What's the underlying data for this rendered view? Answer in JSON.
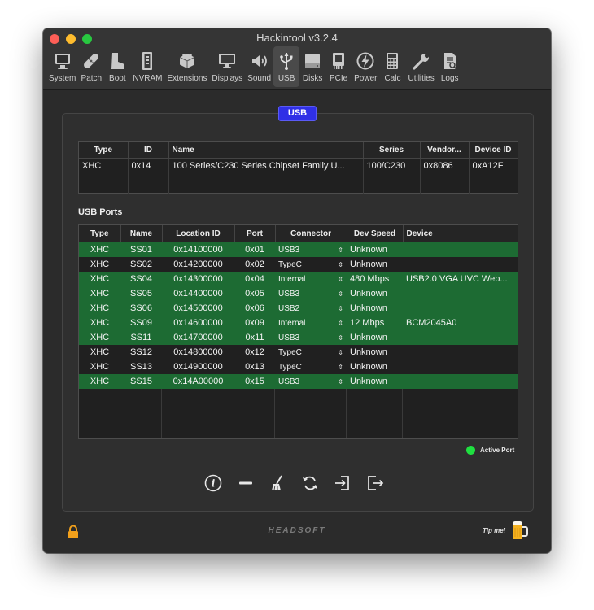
{
  "app": {
    "title": "Hackintool v3.2.4"
  },
  "toolbar": [
    {
      "label": "System",
      "icon": "system-icon"
    },
    {
      "label": "Patch",
      "icon": "patch-icon"
    },
    {
      "label": "Boot",
      "icon": "boot-icon"
    },
    {
      "label": "NVRAM",
      "icon": "nvram-icon"
    },
    {
      "label": "Extensions",
      "icon": "extensions-icon"
    },
    {
      "label": "Displays",
      "icon": "displays-icon"
    },
    {
      "label": "Sound",
      "icon": "sound-icon"
    },
    {
      "label": "USB",
      "icon": "usb-icon",
      "active": true
    },
    {
      "label": "Disks",
      "icon": "disks-icon"
    },
    {
      "label": "PCIe",
      "icon": "pcie-icon"
    },
    {
      "label": "Power",
      "icon": "power-icon"
    },
    {
      "label": "Calc",
      "icon": "calc-icon"
    },
    {
      "label": "Utilities",
      "icon": "utilities-icon"
    },
    {
      "label": "Logs",
      "icon": "logs-icon"
    }
  ],
  "panel": {
    "badge": "USB"
  },
  "controllers": {
    "columns": [
      "Type",
      "ID",
      "Name",
      "Series",
      "Vendor...",
      "Device ID"
    ],
    "rows": [
      {
        "type": "XHC",
        "id": "0x14",
        "name": "100 Series/C230 Series Chipset Family U...",
        "series": "100/C230",
        "vendor": "0x8086",
        "device_id": "0xA12F"
      }
    ]
  },
  "usb_ports": {
    "title": "USB Ports",
    "columns": [
      "Type",
      "Name",
      "Location ID",
      "Port",
      "Connector",
      "Dev Speed",
      "Device"
    ],
    "rows": [
      {
        "type": "XHC",
        "name": "SS01",
        "location": "0x14100000",
        "port": "0x01",
        "connector": "USB3",
        "speed": "Unknown",
        "device": "",
        "active": true
      },
      {
        "type": "XHC",
        "name": "SS02",
        "location": "0x14200000",
        "port": "0x02",
        "connector": "TypeC",
        "speed": "Unknown",
        "device": "",
        "active": false
      },
      {
        "type": "XHC",
        "name": "SS04",
        "location": "0x14300000",
        "port": "0x04",
        "connector": "Internal",
        "speed": "480 Mbps",
        "device": "USB2.0 VGA UVC Web...",
        "active": true
      },
      {
        "type": "XHC",
        "name": "SS05",
        "location": "0x14400000",
        "port": "0x05",
        "connector": "USB3",
        "speed": "Unknown",
        "device": "",
        "active": true
      },
      {
        "type": "XHC",
        "name": "SS06",
        "location": "0x14500000",
        "port": "0x06",
        "connector": "USB2",
        "speed": "Unknown",
        "device": "",
        "active": true
      },
      {
        "type": "XHC",
        "name": "SS09",
        "location": "0x14600000",
        "port": "0x09",
        "connector": "Internal",
        "speed": "12 Mbps",
        "device": "BCM2045A0",
        "active": true
      },
      {
        "type": "XHC",
        "name": "SS11",
        "location": "0x14700000",
        "port": "0x11",
        "connector": "USB3",
        "speed": "Unknown",
        "device": "",
        "active": true
      },
      {
        "type": "XHC",
        "name": "SS12",
        "location": "0x14800000",
        "port": "0x12",
        "connector": "TypeC",
        "speed": "Unknown",
        "device": "",
        "active": false
      },
      {
        "type": "XHC",
        "name": "SS13",
        "location": "0x14900000",
        "port": "0x13",
        "connector": "TypeC",
        "speed": "Unknown",
        "device": "",
        "active": false
      },
      {
        "type": "XHC",
        "name": "SS15",
        "location": "0x14A00000",
        "port": "0x15",
        "connector": "USB3",
        "speed": "Unknown",
        "device": "",
        "active": true
      }
    ]
  },
  "legend": {
    "label": "Active Port",
    "color": "#1fe040"
  },
  "colors": {
    "active_row": "#1d6b33",
    "badge": "#3030e6"
  },
  "actions": [
    "info-icon",
    "remove-icon",
    "clean-icon",
    "refresh-icon",
    "import-icon",
    "export-icon"
  ],
  "footer": {
    "brand": "HEADSOFT",
    "tip": "Tip me!"
  }
}
